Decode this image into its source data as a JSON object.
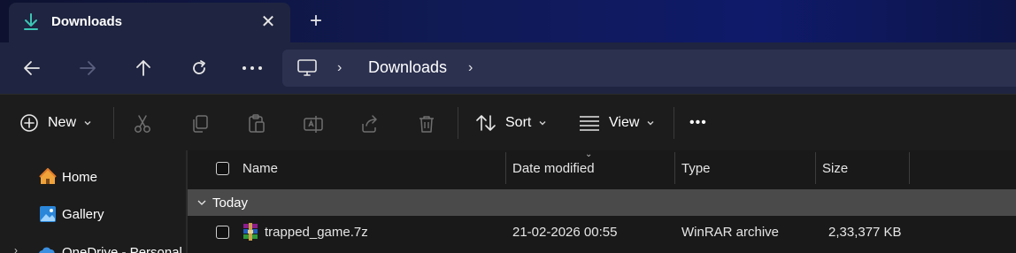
{
  "tab": {
    "title": "Downloads",
    "close": "✕"
  },
  "newtab": "+",
  "nav": {
    "address": {
      "folder": "Downloads",
      "separator": "›"
    }
  },
  "commands": {
    "new_label": "New",
    "sort_label": "Sort",
    "view_label": "View",
    "more": "•••"
  },
  "sidebar": {
    "items": [
      {
        "label": "Home",
        "icon": "home-icon"
      },
      {
        "label": "Gallery",
        "icon": "gallery-icon"
      },
      {
        "label": "OneDrive - Personal",
        "icon": "onedrive-icon"
      }
    ]
  },
  "columns": {
    "name": "Name",
    "date": "Date modified",
    "type": "Type",
    "size": "Size"
  },
  "group": {
    "label": "Today"
  },
  "files": [
    {
      "name": "trapped_game.7z",
      "date": "21-02-2026 00:55",
      "type": "WinRAR archive",
      "size": "2,33,377 KB",
      "icon": "winrar-archive-icon"
    }
  ],
  "colors": {
    "titlebar_gradient_start": "#0e1230",
    "titlebar_gradient_end": "#0f1a6a",
    "tab_bg": "#1f2440",
    "address_bg": "#2c3150",
    "accent_download": "#3cc6b4",
    "group_bg": "#4a4a4a"
  }
}
